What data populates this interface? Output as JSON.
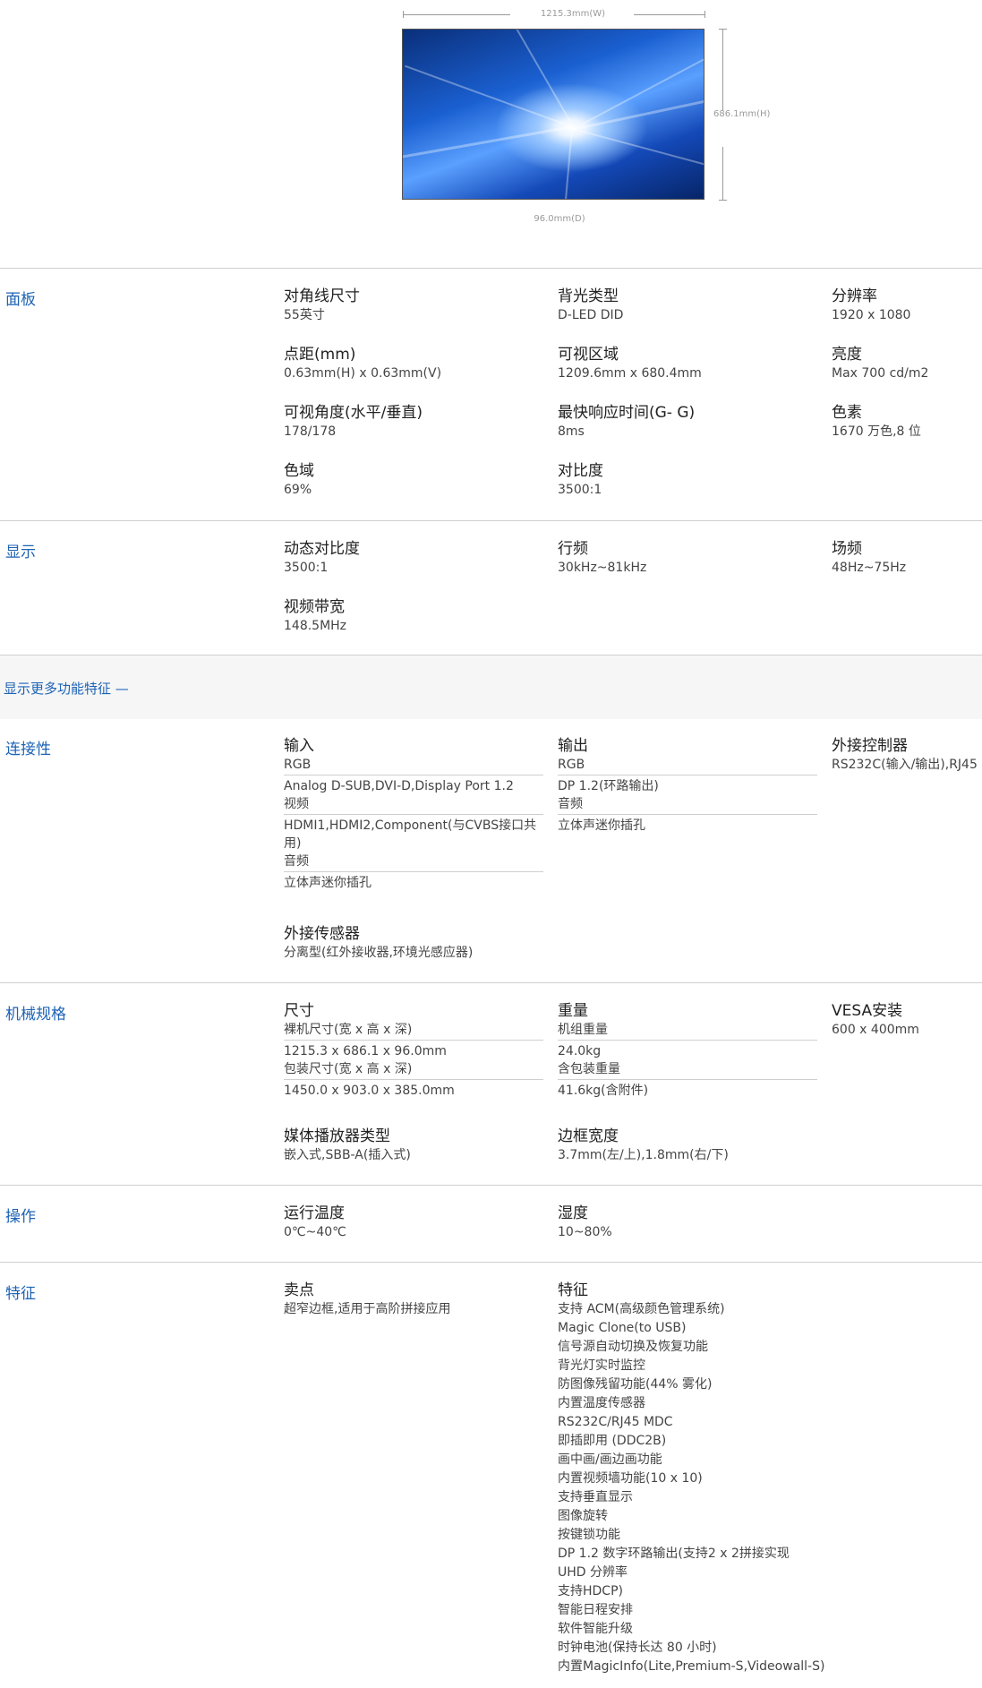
{
  "dimensions": {
    "width": "1215.3mm(W)",
    "height": "686.1mm(H)",
    "depth": "96.0mm(D)"
  },
  "panel": {
    "title": "面板",
    "diag_title": "对角线尺寸",
    "diag_value": "55英寸",
    "backlight_title": "背光类型",
    "backlight_value": "D-LED DID",
    "res_title": "分辨率",
    "res_value": "1920 x 1080",
    "pitch_title": "点距(mm)",
    "pitch_value": "0.63mm(H) x 0.63mm(V)",
    "area_title": "可视区域",
    "area_value": "1209.6mm x 680.4mm",
    "bright_title": "亮度",
    "bright_value": "Max 700 cd/m2",
    "angle_title": "可视角度(水平/垂直)",
    "angle_value": "178/178",
    "resp_title": "最快响应时间(G- G)",
    "resp_value": "8ms",
    "color_title": "色素",
    "color_value": "1670 万色,8 位",
    "gamut_title": "色域",
    "gamut_value": "69%",
    "contrast_title": "对比度",
    "contrast_value": "3500:1"
  },
  "display": {
    "title": "显示",
    "dyn_title": "动态对比度",
    "dyn_value": "3500:1",
    "hfreq_title": "行频",
    "hfreq_value": "30kHz~81kHz",
    "vfreq_title": "场频",
    "vfreq_value": "48Hz~75Hz",
    "bw_title": "视频带宽",
    "bw_value": "148.5MHz"
  },
  "more_features": "显示更多功能特征 —",
  "connectivity": {
    "title": "连接性",
    "input_title": "输入",
    "input_rgb_label": "RGB",
    "input_rgb_value": "Analog D-SUB,DVI-D,Display Port 1.2",
    "input_video_label": "视频",
    "input_video_value": "HDMI1,HDMI2,Component(与CVBS接口共用)",
    "input_audio_label": "音频",
    "input_audio_value": "立体声迷你插孔",
    "sensor_title": "外接传感器",
    "sensor_value": "分离型(红外接收器,环境光感应器)",
    "output_title": "输出",
    "output_rgb_label": "RGB",
    "output_rgb_value": "DP 1.2(环路输出)",
    "output_audio_label": "音频",
    "output_audio_value": "立体声迷你插孔",
    "ext_title": "外接控制器",
    "ext_value": "RS232C(输入/输出),RJ45"
  },
  "mechanical": {
    "title": "机械规格",
    "size_title": "尺寸",
    "set_size_label": "裸机尺寸(宽 x 高 x 深)",
    "set_size_value": "1215.3 x 686.1 x 96.0mm",
    "pkg_size_label": "包装尺寸(宽 x 高 x 深)",
    "pkg_size_value": "1450.0 x 903.0 x 385.0mm",
    "weight_title": "重量",
    "set_weight_label": "机组重量",
    "set_weight_value": "24.0kg",
    "pkg_weight_label": "含包装重量",
    "pkg_weight_value": "41.6kg(含附件)",
    "vesa_title": "VESA安装",
    "vesa_value": "600 x 400mm",
    "media_title": "媒体播放器类型",
    "media_value": "嵌入式,SBB-A(插入式)",
    "bezel_title": "边框宽度",
    "bezel_value": "3.7mm(左/上),1.8mm(右/下)"
  },
  "operation": {
    "title": "操作",
    "temp_title": "运行温度",
    "temp_value": "0℃~40℃",
    "hum_title": "湿度",
    "hum_value": "10~80%"
  },
  "features": {
    "title": "特征",
    "selling_title": "卖点",
    "selling_value": "超窄边框,适用于高阶拼接应用",
    "feat_title": "特征",
    "lines": [
      "支持 ACM(高级颜色管理系统)",
      "Magic Clone(to USB)",
      "信号源自动切换及恢复功能",
      "背光灯实时监控",
      "防图像残留功能(44% 雾化)",
      "内置温度传感器",
      "RS232C/RJ45 MDC",
      "即插即用 (DDC2B)",
      "画中画/画边画功能",
      "内置视频墙功能(10 x 10)",
      "支持垂直显示",
      "图像旋转",
      "按键锁功能",
      "DP 1.2 数字环路输出(支持2 x 2拼接实现",
      "UHD 分辨率",
      "支持HDCP)",
      "智能日程安排",
      "软件智能升级",
      "时钟电池(保持长达 80 小时)",
      "内置MagicInfo(Lite,Premium-S,Videowall-S)"
    ]
  }
}
